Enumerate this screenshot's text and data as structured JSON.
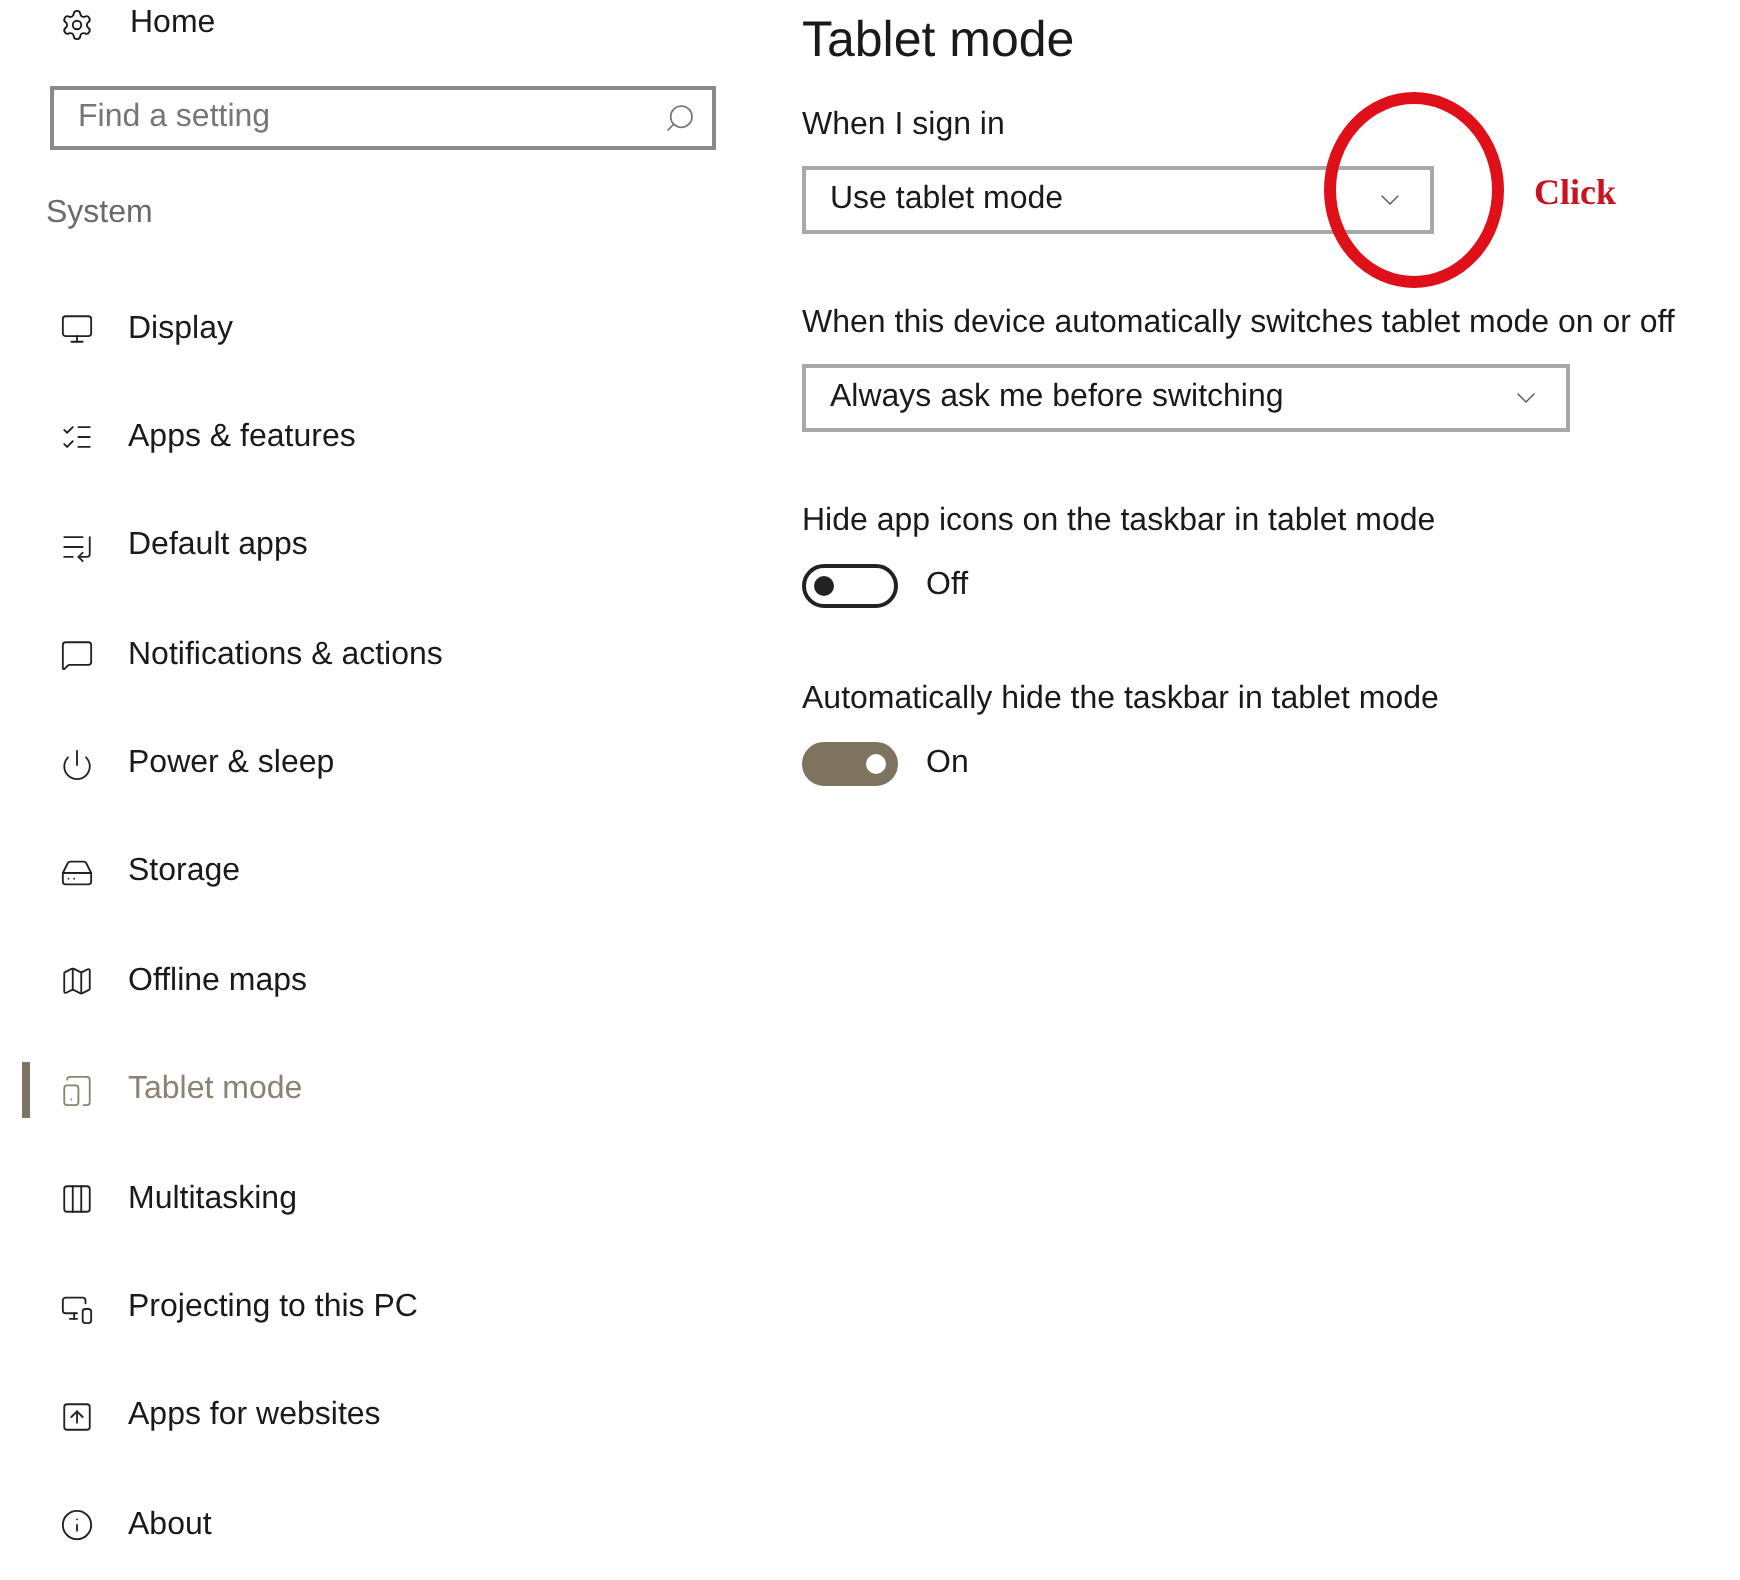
{
  "sidebar": {
    "home": "Home",
    "search": {
      "placeholder": "Find a setting"
    },
    "section": "System",
    "items": [
      {
        "label": "Display",
        "selected": false
      },
      {
        "label": "Apps & features",
        "selected": false
      },
      {
        "label": "Default apps",
        "selected": false
      },
      {
        "label": "Notifications & actions",
        "selected": false
      },
      {
        "label": "Power & sleep",
        "selected": false
      },
      {
        "label": "Storage",
        "selected": false
      },
      {
        "label": "Offline maps",
        "selected": false
      },
      {
        "label": "Tablet mode",
        "selected": true
      },
      {
        "label": "Multitasking",
        "selected": false
      },
      {
        "label": "Projecting to this PC",
        "selected": false
      },
      {
        "label": "Apps for websites",
        "selected": false
      },
      {
        "label": "About",
        "selected": false
      }
    ]
  },
  "page": {
    "title": "Tablet mode",
    "settings": [
      {
        "kind": "dropdown",
        "label": "When I sign in",
        "value": "Use tablet mode"
      },
      {
        "kind": "dropdown",
        "label": "When this device automatically switches tablet mode on or off",
        "value": "Always ask me before switching"
      },
      {
        "kind": "toggle",
        "label": "Hide app icons on the taskbar in tablet mode",
        "on": false,
        "state": "Off"
      },
      {
        "kind": "toggle",
        "label": "Automatically hide the taskbar in tablet mode",
        "on": true,
        "state": "On"
      }
    ]
  },
  "annotation": {
    "text": "Click"
  }
}
